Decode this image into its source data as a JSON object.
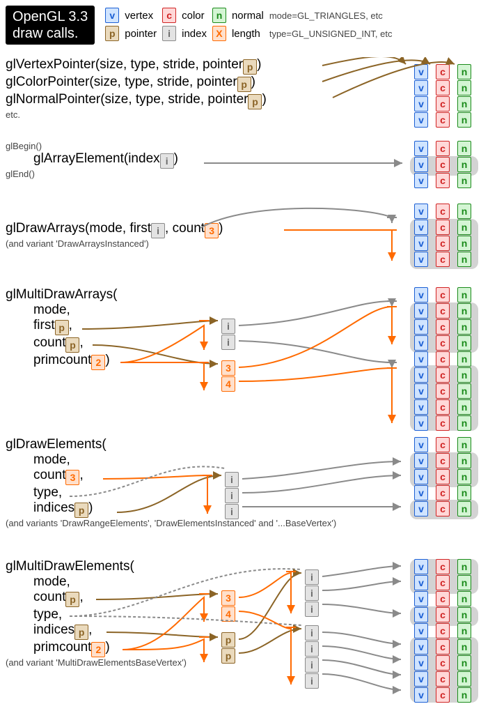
{
  "title_line1": "OpenGL 3.3",
  "title_line2": "draw calls.",
  "legend": {
    "v": "v",
    "c": "c",
    "n": "n",
    "p": "p",
    "i": "i",
    "x": "X",
    "vertex": "vertex",
    "color": "color",
    "normal": "normal",
    "pointer": "pointer",
    "index": "index",
    "length": "length",
    "mode": "mode=GL_TRIANGLES, etc",
    "type": "type=GL_UNSIGNED_INT, etc"
  },
  "sec1": {
    "l1a": "glVertexPointer(size, type, stride, pointer",
    "l1b": ")",
    "l2a": "glColorPointer(size, type, stride, pointer",
    "l2b": ")",
    "l3a": "glNormalPointer(size, type, stride, pointer",
    "l3b": ")",
    "etc": "etc."
  },
  "sec2": {
    "begin": "glBegin()",
    "line": "glArrayElement(index",
    "line_b": ")",
    "end": "glEnd()"
  },
  "sec3": {
    "line_a": "glDrawArrays(mode, first",
    "line_b": ", count",
    "line_c": ")",
    "count": "3",
    "note": "(and variant 'DrawArraysInstanced')"
  },
  "sec4": {
    "h": "glMultiDrawArrays(",
    "mode": "mode,",
    "first": "first",
    "first_b": ",",
    "count": "count",
    "count_b": ",",
    "prim": "primcount",
    "prim_b": ")",
    "primval": "2",
    "c1": "3",
    "c2": "4"
  },
  "sec5": {
    "h": "glDrawElements(",
    "mode": "mode,",
    "count": "count",
    "count_b": ",",
    "countval": "3",
    "type": "type,",
    "indices": "indices",
    "indices_b": ")",
    "note": "(and variants 'DrawRangeElements', 'DrawElementsInstanced' and '...BaseVertex')"
  },
  "sec6": {
    "h": "glMultiDrawElements(",
    "mode": "mode,",
    "count": "count",
    "count_b": ",",
    "type": "type,",
    "indices": "indices",
    "indices_b": ",",
    "prim": "primcount",
    "prim_b": ")",
    "primval": "2",
    "c1": "3",
    "c2": "4",
    "note": "(and variant 'MultiDrawElementsBaseVertex')"
  }
}
